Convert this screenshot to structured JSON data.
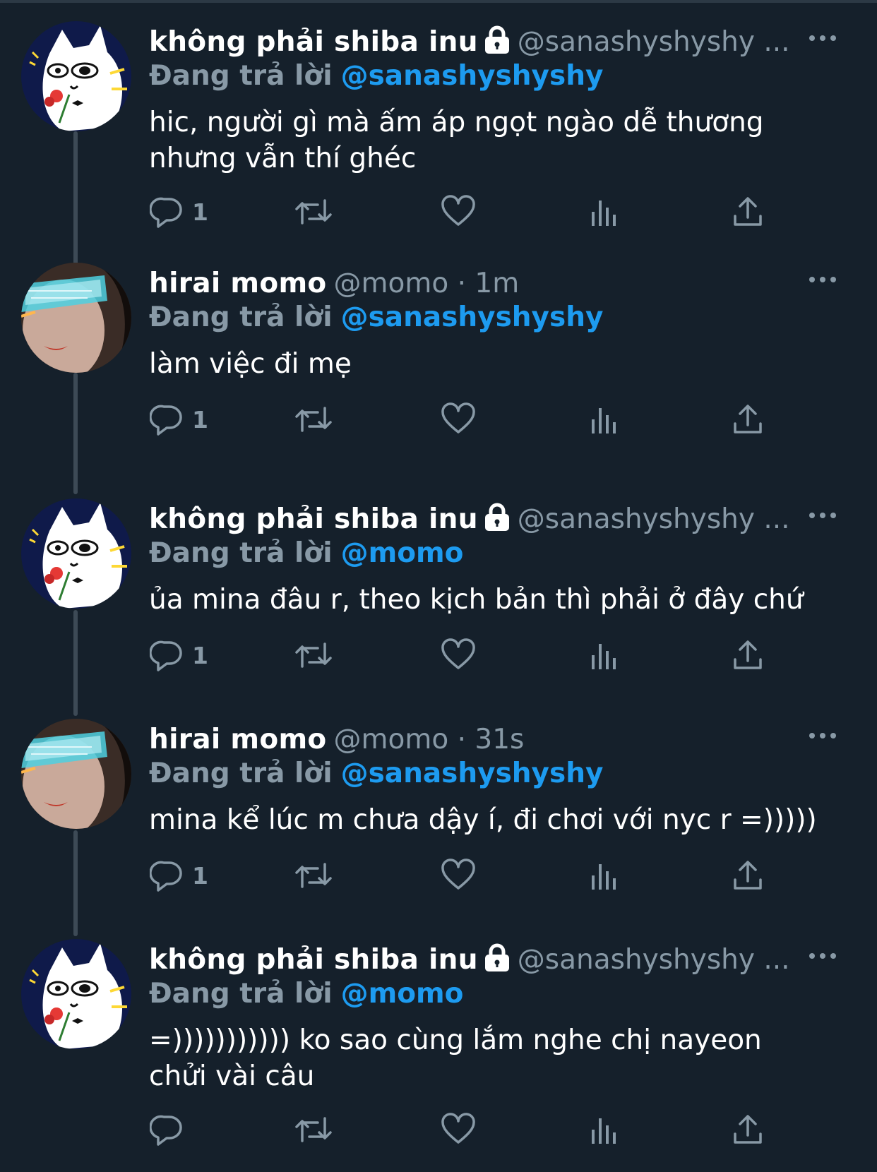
{
  "colors": {
    "background": "#15202b",
    "text": "#ffffff",
    "muted": "#8899a6",
    "accent": "#1d9bf0",
    "thread_line": "#3d4a56"
  },
  "tweets": [
    {
      "name": "không phải shiba inu",
      "locked": true,
      "handle": "@sanashyshyshy ...",
      "reply_label": "Đang trả lời",
      "reply_to": "@sanashyshyshy",
      "text": "hic, người gì mà ấm áp ngọt ngào dễ thương nhưng vẫn thí ghéc",
      "reply_count": "1",
      "avatar": "cat-avatar"
    },
    {
      "name": "hirai momo",
      "locked": false,
      "handle": "@momo · 1m",
      "reply_label": "Đang trả lời",
      "reply_to": "@sanashyshyshy",
      "text": "làm việc đi mẹ",
      "reply_count": "1",
      "avatar": "photo-avatar"
    },
    {
      "name": "không phải shiba inu",
      "locked": true,
      "handle": "@sanashyshyshy ...",
      "reply_label": "Đang trả lời",
      "reply_to": "@momo",
      "text": "ủa mina đâu r, theo kịch bản thì phải ở đây chứ",
      "reply_count": "1",
      "avatar": "cat-avatar"
    },
    {
      "name": "hirai momo",
      "locked": false,
      "handle": "@momo · 31s",
      "reply_label": "Đang trả lời",
      "reply_to": "@sanashyshyshy",
      "text": "mina kể lúc m chưa dậy í, đi chơi với nyc r =)))))",
      "reply_count": "1",
      "avatar": "photo-avatar"
    },
    {
      "name": "không phải shiba inu",
      "locked": true,
      "handle": "@sanashyshyshy ...",
      "reply_label": "Đang trả lời",
      "reply_to": "@momo",
      "text": "=))))))))))) ko sao cùng lắm nghe chị nayeon chửi vài câu",
      "reply_count": "",
      "avatar": "cat-avatar"
    }
  ],
  "icons": {
    "reply": "reply-icon",
    "retweet": "retweet-icon",
    "like": "heart-icon",
    "views": "analytics-icon",
    "share": "share-icon",
    "more": "more-icon",
    "lock": "lock-icon"
  }
}
